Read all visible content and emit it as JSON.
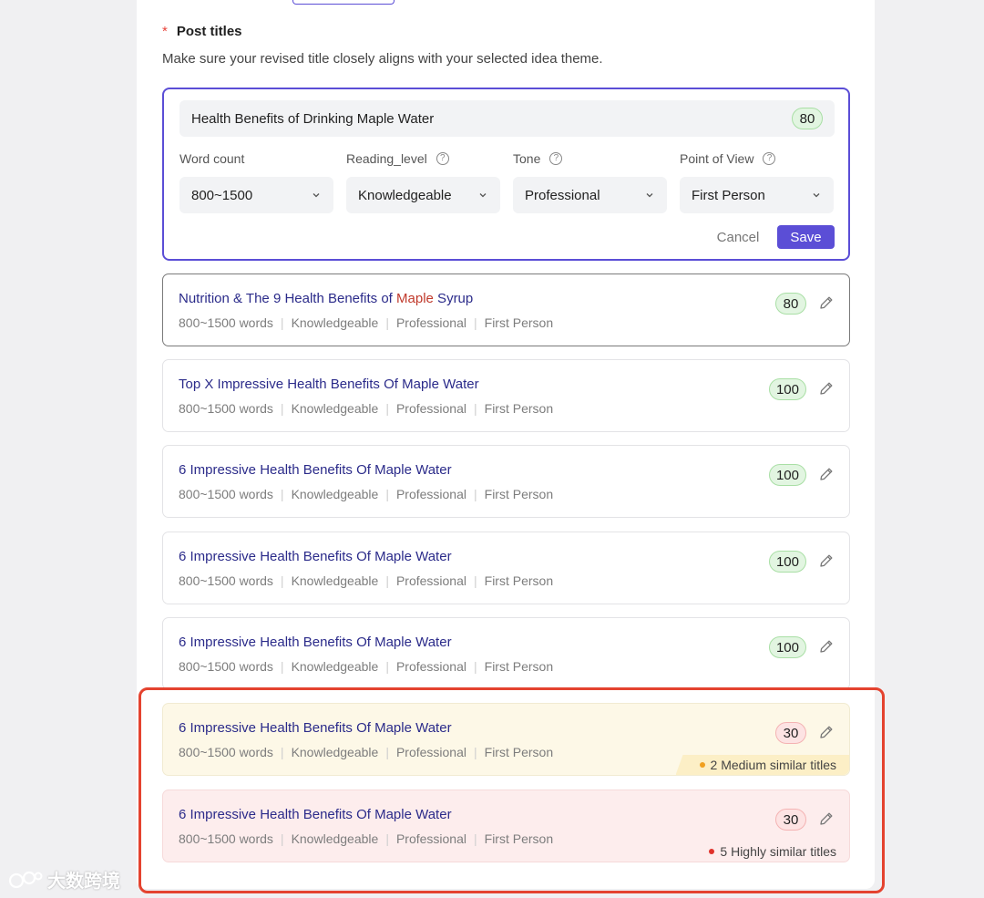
{
  "section": {
    "required_mark": "*",
    "title": "Post titles",
    "description": "Make sure your revised title closely aligns with your selected idea theme."
  },
  "editor": {
    "title_value": "Health Benefits of Drinking Maple Water",
    "score": "80",
    "fields": [
      {
        "label": "Word count",
        "value": "800~1500",
        "help": false
      },
      {
        "label": "Reading_level",
        "value": "Knowledgeable",
        "help": true
      },
      {
        "label": "Tone",
        "value": "Professional",
        "help": true
      },
      {
        "label": "Point of View",
        "value": "First Person",
        "help": true
      }
    ],
    "cancel_label": "Cancel",
    "save_label": "Save"
  },
  "cards": [
    {
      "title_pre": "Nutrition & The 9 Health Benefits of ",
      "title_hl": "Maple",
      "title_post": " Syrup",
      "score": "80",
      "meta": [
        "800~1500 words",
        "Knowledgeable",
        "Professional",
        "First Person"
      ]
    },
    {
      "title_pre": "Top X Impressive Health Benefits Of Maple Water",
      "title_hl": "",
      "title_post": "",
      "score": "100",
      "meta": [
        "800~1500 words",
        "Knowledgeable",
        "Professional",
        "First Person"
      ]
    },
    {
      "title_pre": "6 Impressive Health Benefits Of Maple Water",
      "title_hl": "",
      "title_post": "",
      "score": "100",
      "meta": [
        "800~1500 words",
        "Knowledgeable",
        "Professional",
        "First Person"
      ]
    },
    {
      "title_pre": "6 Impressive Health Benefits Of Maple Water",
      "title_hl": "",
      "title_post": "",
      "score": "100",
      "meta": [
        "800~1500 words",
        "Knowledgeable",
        "Professional",
        "First Person"
      ]
    },
    {
      "title_pre": "6 Impressive Health Benefits Of Maple Water",
      "title_hl": "",
      "title_post": "",
      "score": "100",
      "meta": [
        "800~1500 words",
        "Knowledgeable",
        "Professional",
        "First Person"
      ]
    },
    {
      "title_pre": "6 Impressive Health Benefits Of Maple Water",
      "title_hl": "",
      "title_post": "",
      "score": "30",
      "meta": [
        "800~1500 words",
        "Knowledgeable",
        "Professional",
        "First Person"
      ],
      "similarity": "2 Medium similar titles"
    },
    {
      "title_pre": "6 Impressive Health Benefits Of Maple Water",
      "title_hl": "",
      "title_post": "",
      "score": "30",
      "meta": [
        "800~1500 words",
        "Knowledgeable",
        "Professional",
        "First Person"
      ],
      "similarity": "5 Highly similar titles"
    }
  ],
  "colors": {
    "accent": "#5b4ed6",
    "highlight_frame": "#e4432f",
    "medium_dot": "#f0a020",
    "high_dot": "#e0322b"
  },
  "watermark": "大数跨境"
}
